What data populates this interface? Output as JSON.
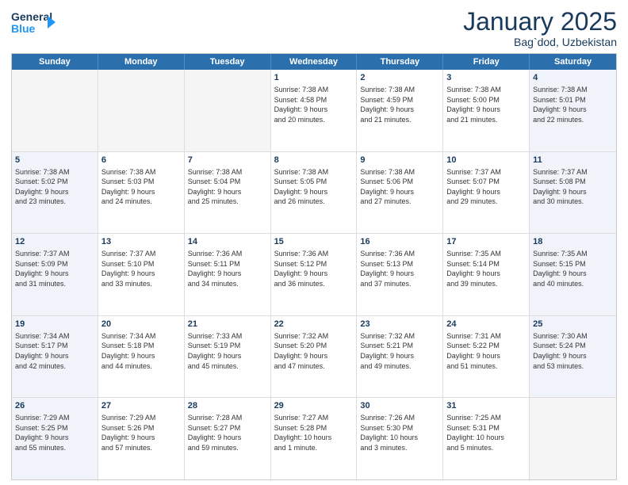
{
  "header": {
    "logo_line1": "General",
    "logo_line2": "Blue",
    "title": "January 2025",
    "subtitle": "Bag`dod, Uzbekistan"
  },
  "days_of_week": [
    "Sunday",
    "Monday",
    "Tuesday",
    "Wednesday",
    "Thursday",
    "Friday",
    "Saturday"
  ],
  "weeks": [
    [
      {
        "day": "",
        "info": ""
      },
      {
        "day": "",
        "info": ""
      },
      {
        "day": "",
        "info": ""
      },
      {
        "day": "1",
        "info": "Sunrise: 7:38 AM\nSunset: 4:58 PM\nDaylight: 9 hours\nand 20 minutes."
      },
      {
        "day": "2",
        "info": "Sunrise: 7:38 AM\nSunset: 4:59 PM\nDaylight: 9 hours\nand 21 minutes."
      },
      {
        "day": "3",
        "info": "Sunrise: 7:38 AM\nSunset: 5:00 PM\nDaylight: 9 hours\nand 21 minutes."
      },
      {
        "day": "4",
        "info": "Sunrise: 7:38 AM\nSunset: 5:01 PM\nDaylight: 9 hours\nand 22 minutes."
      }
    ],
    [
      {
        "day": "5",
        "info": "Sunrise: 7:38 AM\nSunset: 5:02 PM\nDaylight: 9 hours\nand 23 minutes."
      },
      {
        "day": "6",
        "info": "Sunrise: 7:38 AM\nSunset: 5:03 PM\nDaylight: 9 hours\nand 24 minutes."
      },
      {
        "day": "7",
        "info": "Sunrise: 7:38 AM\nSunset: 5:04 PM\nDaylight: 9 hours\nand 25 minutes."
      },
      {
        "day": "8",
        "info": "Sunrise: 7:38 AM\nSunset: 5:05 PM\nDaylight: 9 hours\nand 26 minutes."
      },
      {
        "day": "9",
        "info": "Sunrise: 7:38 AM\nSunset: 5:06 PM\nDaylight: 9 hours\nand 27 minutes."
      },
      {
        "day": "10",
        "info": "Sunrise: 7:37 AM\nSunset: 5:07 PM\nDaylight: 9 hours\nand 29 minutes."
      },
      {
        "day": "11",
        "info": "Sunrise: 7:37 AM\nSunset: 5:08 PM\nDaylight: 9 hours\nand 30 minutes."
      }
    ],
    [
      {
        "day": "12",
        "info": "Sunrise: 7:37 AM\nSunset: 5:09 PM\nDaylight: 9 hours\nand 31 minutes."
      },
      {
        "day": "13",
        "info": "Sunrise: 7:37 AM\nSunset: 5:10 PM\nDaylight: 9 hours\nand 33 minutes."
      },
      {
        "day": "14",
        "info": "Sunrise: 7:36 AM\nSunset: 5:11 PM\nDaylight: 9 hours\nand 34 minutes."
      },
      {
        "day": "15",
        "info": "Sunrise: 7:36 AM\nSunset: 5:12 PM\nDaylight: 9 hours\nand 36 minutes."
      },
      {
        "day": "16",
        "info": "Sunrise: 7:36 AM\nSunset: 5:13 PM\nDaylight: 9 hours\nand 37 minutes."
      },
      {
        "day": "17",
        "info": "Sunrise: 7:35 AM\nSunset: 5:14 PM\nDaylight: 9 hours\nand 39 minutes."
      },
      {
        "day": "18",
        "info": "Sunrise: 7:35 AM\nSunset: 5:15 PM\nDaylight: 9 hours\nand 40 minutes."
      }
    ],
    [
      {
        "day": "19",
        "info": "Sunrise: 7:34 AM\nSunset: 5:17 PM\nDaylight: 9 hours\nand 42 minutes."
      },
      {
        "day": "20",
        "info": "Sunrise: 7:34 AM\nSunset: 5:18 PM\nDaylight: 9 hours\nand 44 minutes."
      },
      {
        "day": "21",
        "info": "Sunrise: 7:33 AM\nSunset: 5:19 PM\nDaylight: 9 hours\nand 45 minutes."
      },
      {
        "day": "22",
        "info": "Sunrise: 7:32 AM\nSunset: 5:20 PM\nDaylight: 9 hours\nand 47 minutes."
      },
      {
        "day": "23",
        "info": "Sunrise: 7:32 AM\nSunset: 5:21 PM\nDaylight: 9 hours\nand 49 minutes."
      },
      {
        "day": "24",
        "info": "Sunrise: 7:31 AM\nSunset: 5:22 PM\nDaylight: 9 hours\nand 51 minutes."
      },
      {
        "day": "25",
        "info": "Sunrise: 7:30 AM\nSunset: 5:24 PM\nDaylight: 9 hours\nand 53 minutes."
      }
    ],
    [
      {
        "day": "26",
        "info": "Sunrise: 7:29 AM\nSunset: 5:25 PM\nDaylight: 9 hours\nand 55 minutes."
      },
      {
        "day": "27",
        "info": "Sunrise: 7:29 AM\nSunset: 5:26 PM\nDaylight: 9 hours\nand 57 minutes."
      },
      {
        "day": "28",
        "info": "Sunrise: 7:28 AM\nSunset: 5:27 PM\nDaylight: 9 hours\nand 59 minutes."
      },
      {
        "day": "29",
        "info": "Sunrise: 7:27 AM\nSunset: 5:28 PM\nDaylight: 10 hours\nand 1 minute."
      },
      {
        "day": "30",
        "info": "Sunrise: 7:26 AM\nSunset: 5:30 PM\nDaylight: 10 hours\nand 3 minutes."
      },
      {
        "day": "31",
        "info": "Sunrise: 7:25 AM\nSunset: 5:31 PM\nDaylight: 10 hours\nand 5 minutes."
      },
      {
        "day": "",
        "info": ""
      }
    ]
  ]
}
